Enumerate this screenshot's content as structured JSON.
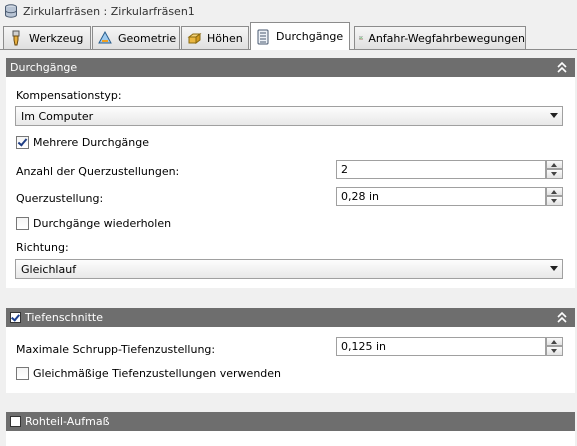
{
  "window": {
    "title": "Zirkularfräsen : Zirkularfräsen1",
    "icon": "operation-stack-icon"
  },
  "tabs": [
    {
      "label": "Werkzeug",
      "icon": "tool-icon",
      "active": false
    },
    {
      "label": "Geometrie",
      "icon": "geometry-icon",
      "active": false
    },
    {
      "label": "Höhen",
      "icon": "heights-icon",
      "active": false
    },
    {
      "label": "Durchgänge",
      "icon": "passes-icon",
      "active": true
    },
    {
      "label": "Anfahr-Wegfahrbewegungen",
      "icon": "linking-icon",
      "active": false
    }
  ],
  "passes": {
    "title": "Durchgänge",
    "comp_label": "Kompensationstyp:",
    "comp_value": "Im Computer",
    "multiple_label": "Mehrere Durchgänge",
    "multiple_checked": true,
    "stepovers_label": "Anzahl der Querzustellungen:",
    "stepovers_value": "2",
    "stepover_label": "Querzustellung:",
    "stepover_value": "0,28 in",
    "repeat_label": "Durchgänge wiederholen",
    "repeat_checked": false,
    "direction_label": "Richtung:",
    "direction_value": "Gleichlauf"
  },
  "depth": {
    "title": "Tiefenschnitte",
    "enabled": true,
    "max_label": "Maximale Schrupp-Tiefenzustellung:",
    "max_value": "0,125 in",
    "even_label": "Gleichmäßige Tiefenzustellungen verwenden",
    "even_checked": false
  },
  "stock": {
    "title": "Rohteil-Aufmaß",
    "enabled": false
  },
  "colors": {
    "section_header": "#6e6e6e",
    "check": "#203e84"
  }
}
